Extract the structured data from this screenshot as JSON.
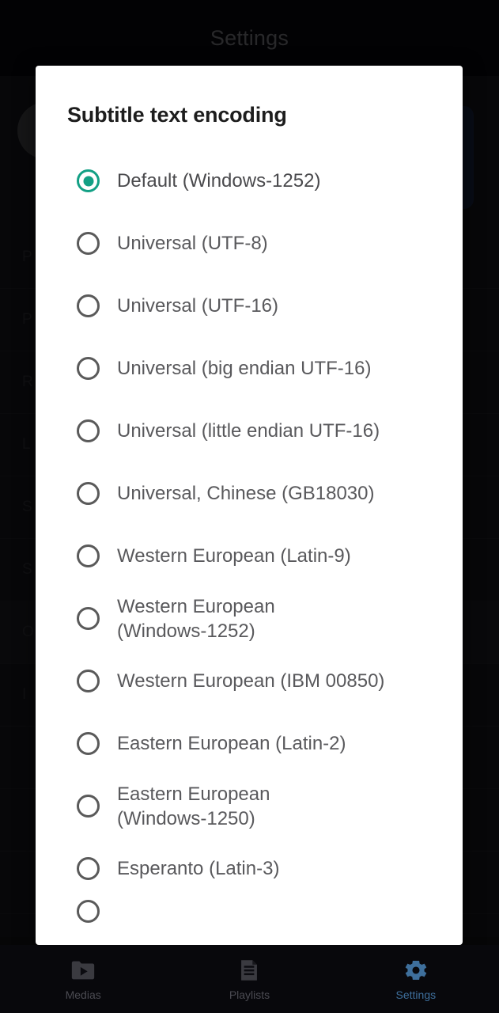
{
  "app": {
    "header_title": "Settings",
    "background_rows": [
      "P",
      "P",
      "R",
      "L",
      "S",
      "S",
      "O",
      "I"
    ]
  },
  "dialog": {
    "title": "Subtitle text encoding",
    "selected_index": 0,
    "accent_color": "#13a085",
    "options": [
      {
        "label": "Default (Windows-1252)",
        "selected": true
      },
      {
        "label": "Universal (UTF-8)",
        "selected": false
      },
      {
        "label": "Universal (UTF-16)",
        "selected": false
      },
      {
        "label": "Universal (big endian UTF-16)",
        "selected": false
      },
      {
        "label": "Universal (little endian UTF-16)",
        "selected": false
      },
      {
        "label": "Universal, Chinese (GB18030)",
        "selected": false
      },
      {
        "label": "Western European (Latin-9)",
        "selected": false
      },
      {
        "label": "Western European\n(Windows-1252)",
        "selected": false
      },
      {
        "label": "Western European (IBM 00850)",
        "selected": false
      },
      {
        "label": "Eastern European (Latin-2)",
        "selected": false
      },
      {
        "label": "Eastern European\n(Windows-1250)",
        "selected": false
      },
      {
        "label": "Esperanto (Latin-3)",
        "selected": false
      },
      {
        "label": "",
        "selected": false
      }
    ]
  },
  "bottom_nav": {
    "active": "Settings",
    "active_color": "#3e6f9c",
    "items": [
      {
        "label": "Medias",
        "icon": "folder-play-icon"
      },
      {
        "label": "Playlists",
        "icon": "document-lines-icon"
      },
      {
        "label": "Settings",
        "icon": "gear-icon"
      }
    ]
  }
}
